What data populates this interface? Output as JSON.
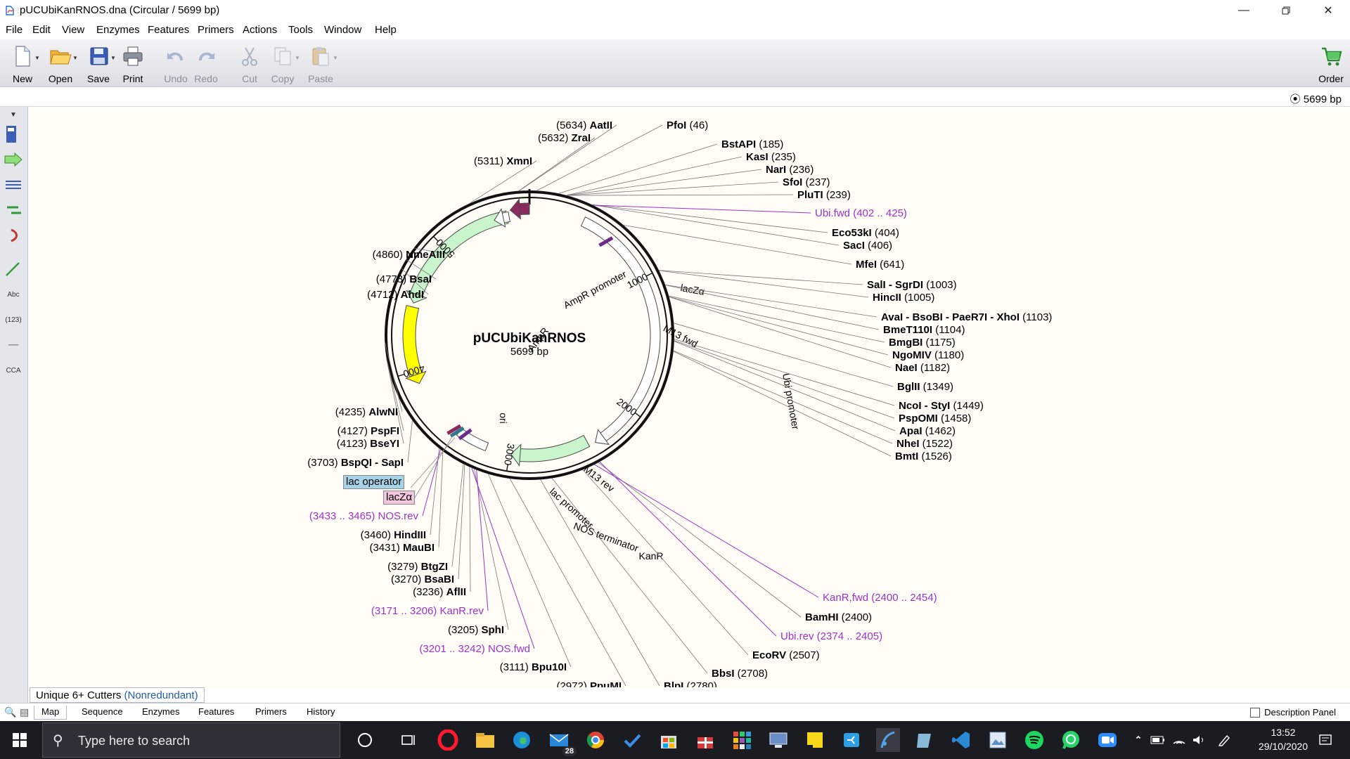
{
  "window": {
    "title": "pUCUbiKanRNOS.dna  (Circular / 5699 bp)",
    "controls": [
      "minimize",
      "restore",
      "close"
    ]
  },
  "menu": [
    "File",
    "Edit",
    "View",
    "Enzymes",
    "Features",
    "Primers",
    "Actions",
    "Tools",
    "Window",
    "Help"
  ],
  "toolbar": {
    "new": "New",
    "open": "Open",
    "save": "Save",
    "print": "Print",
    "undo": "Undo",
    "redo": "Redo",
    "cut": "Cut",
    "copy": "Copy",
    "paste": "Paste",
    "order": "Order"
  },
  "info": {
    "bp_count": "5699 bp"
  },
  "map": {
    "name": "pUCUbiKanRNOS",
    "length": "5699 bp",
    "total_bp": 5699,
    "ruler": [
      {
        "label": "1000",
        "pos": 1000
      },
      {
        "label": "2000",
        "pos": 2000
      },
      {
        "label": "3000",
        "pos": 3000
      },
      {
        "label": "4000",
        "pos": 4000
      },
      {
        "label": "5000",
        "pos": 5000
      }
    ],
    "features": [
      {
        "label": "lacZα",
        "start": 5560,
        "end": 5699,
        "color": "#8b2a5c",
        "type": "arrow",
        "dir": -1
      },
      {
        "label": "Ubi promoter",
        "start": 400,
        "end": 2350,
        "color": "#ffffff",
        "type": "arrow",
        "dir": 1
      },
      {
        "label": "KanR",
        "start": 2400,
        "end": 2990,
        "color": "#c8f5cc",
        "type": "arrow",
        "dir": 1
      },
      {
        "label": "AmpR",
        "start": 4520,
        "end": 5530,
        "color": "#c8f5cc",
        "type": "arrow",
        "dir": -1
      },
      {
        "label": "AmpR promoter",
        "start": 5430,
        "end": 5545,
        "color": "#ffffff",
        "type": "arrow",
        "dir": -1
      },
      {
        "label": "ori",
        "start": 3900,
        "end": 4490,
        "color": "#ffff00",
        "type": "arrow",
        "dir": -1
      },
      {
        "label": "NOS terminator",
        "start": 3180,
        "end": 3420,
        "color": "#ffffff",
        "type": "box",
        "dir": 0
      }
    ],
    "feature_labels": [
      {
        "text": "lacZα",
        "rot": 10
      },
      {
        "text": "Ubi promoter",
        "rot": 80
      },
      {
        "text": "KanR",
        "rot": 0
      },
      {
        "text": "AmpR promoter",
        "rot": -28
      },
      {
        "text": "AmpR",
        "rot": -52
      },
      {
        "text": "ori",
        "rot": 90
      },
      {
        "text": "M13 fwd",
        "rot": 28
      },
      {
        "text": "M13 rev",
        "rot": 38
      },
      {
        "text": "lac promoter",
        "rot": 42
      },
      {
        "text": "NOS terminator",
        "rot": 20
      }
    ],
    "enzyme_sites": [
      {
        "name": "AatII",
        "pos": "(5634)",
        "pos_first": true
      },
      {
        "name": "ZraI",
        "pos": "(5632)",
        "pos_first": true
      },
      {
        "name": "XmnI",
        "pos": "(5311)",
        "pos_first": true
      },
      {
        "name": "PfoI",
        "pos": "(46)",
        "pos_first": false
      },
      {
        "name": "BstAPI",
        "pos": "(185)",
        "pos_first": false
      },
      {
        "name": "KasI",
        "pos": "(235)",
        "pos_first": false
      },
      {
        "name": "NarI",
        "pos": "(236)",
        "pos_first": false
      },
      {
        "name": "SfoI",
        "pos": "(237)",
        "pos_first": false
      },
      {
        "name": "PluTI",
        "pos": "(239)",
        "pos_first": false
      },
      {
        "name": "Eco53kI",
        "pos": "(404)",
        "pos_first": false
      },
      {
        "name": "SacI",
        "pos": "(406)",
        "pos_first": false
      },
      {
        "name": "MfeI",
        "pos": "(641)",
        "pos_first": false
      },
      {
        "name": "SalI - SgrDI",
        "pos": "(1003)",
        "pos_first": false
      },
      {
        "name": "HincII",
        "pos": "(1005)",
        "pos_first": false
      },
      {
        "name": "AvaI - BsoBI - PaeR7I - XhoI",
        "pos": "(1103)",
        "pos_first": false
      },
      {
        "name": "BmeT110I",
        "pos": "(1104)",
        "pos_first": false
      },
      {
        "name": "BmgBI",
        "pos": "(1175)",
        "pos_first": false
      },
      {
        "name": "NgoMIV",
        "pos": "(1180)",
        "pos_first": false
      },
      {
        "name": "NaeI",
        "pos": "(1182)",
        "pos_first": false
      },
      {
        "name": "BglII",
        "pos": "(1349)",
        "pos_first": false
      },
      {
        "name": "NcoI - StyI",
        "pos": "(1449)",
        "pos_first": false
      },
      {
        "name": "PspOMI",
        "pos": "(1458)",
        "pos_first": false
      },
      {
        "name": "ApaI",
        "pos": "(1462)",
        "pos_first": false
      },
      {
        "name": "NheI",
        "pos": "(1522)",
        "pos_first": false
      },
      {
        "name": "BmtI",
        "pos": "(1526)",
        "pos_first": false
      },
      {
        "name": "BamHI",
        "pos": "(2400)",
        "pos_first": false
      },
      {
        "name": "EcoRV",
        "pos": "(2507)",
        "pos_first": false
      },
      {
        "name": "BbsI",
        "pos": "(2708)",
        "pos_first": false
      },
      {
        "name": "BlpI",
        "pos": "(2780)",
        "pos_first": false
      },
      {
        "name": "PpuMI",
        "pos": "(2972)",
        "pos_first": true
      },
      {
        "name": "Bpu10I",
        "pos": "(3111)",
        "pos_first": true
      },
      {
        "name": "SphI",
        "pos": "(3205)",
        "pos_first": true
      },
      {
        "name": "BtgZI",
        "pos": "(3279)",
        "pos_first": true
      },
      {
        "name": "BsaBI",
        "pos": "(3270)",
        "pos_first": true
      },
      {
        "name": "AflII",
        "pos": "(3236)",
        "pos_first": true
      },
      {
        "name": "HindIII",
        "pos": "(3460)",
        "pos_first": true
      },
      {
        "name": "MauBI",
        "pos": "(3431)",
        "pos_first": true
      },
      {
        "name": "BspQI - SapI",
        "pos": "(3703)",
        "pos_first": true
      },
      {
        "name": "PspFI",
        "pos": "(4127)",
        "pos_first": true
      },
      {
        "name": "BseYI",
        "pos": "(4123)",
        "pos_first": true
      },
      {
        "name": "AlwNI",
        "pos": "(4235)",
        "pos_first": true
      },
      {
        "name": "AhdI",
        "pos": "(4712)",
        "pos_first": true
      },
      {
        "name": "BsaI",
        "pos": "(4773)",
        "pos_first": true
      },
      {
        "name": "NmeAIII",
        "pos": "(4860)",
        "pos_first": true
      }
    ],
    "primers": [
      {
        "name": "Ubi.fwd",
        "range": "(402 .. 425)",
        "pos_first": false
      },
      {
        "name": "KanR,fwd",
        "range": "(2400 .. 2454)",
        "pos_first": false
      },
      {
        "name": "Ubi.rev",
        "range": "(2374 .. 2405)",
        "pos_first": false
      },
      {
        "name": "KanR.rev",
        "range": "(3171 .. 3206)",
        "pos_first": true
      },
      {
        "name": "NOS.fwd",
        "range": "(3201 .. 3242)",
        "pos_first": true
      },
      {
        "name": "NOS.rev",
        "range": "(3433 .. 3465)",
        "pos_first": true
      }
    ],
    "callouts": [
      {
        "text": "lac operator",
        "bg": "#a6d3e8"
      },
      {
        "text": "lacZα",
        "bg": "#f2c6dc"
      }
    ]
  },
  "colors": {
    "primer": "#9a33cc",
    "accent": "#1f5ea8"
  },
  "footer": {
    "cutter_label": "Unique 6+ Cutters",
    "cutter_mode": "(Nonredundant)",
    "tabs": [
      "Map",
      "Sequence",
      "Enzymes",
      "Features",
      "Primers",
      "History"
    ],
    "description_panel": "Description Panel"
  },
  "taskbar": {
    "search_placeholder": "Type here to search",
    "mail_badge": "28",
    "time": "13:52",
    "date": "29/10/2020"
  }
}
